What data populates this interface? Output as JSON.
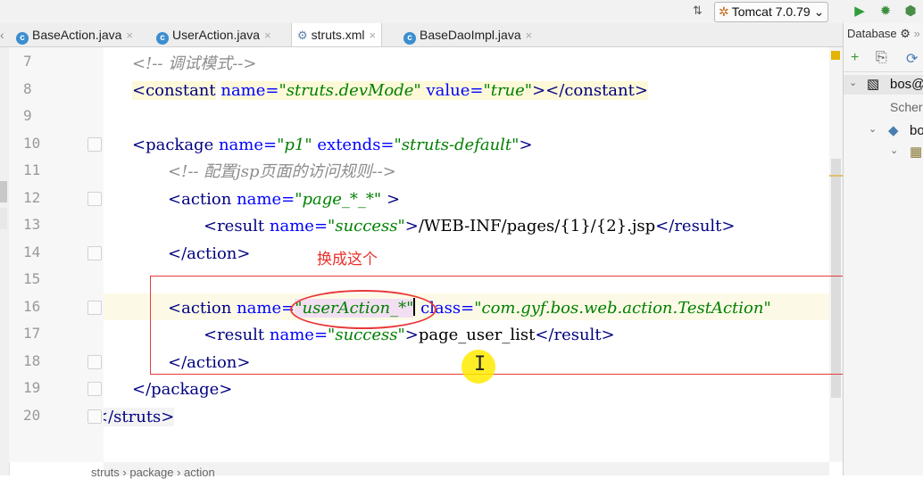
{
  "toolbar": {
    "run_config": "Tomcat 7.0.79",
    "sort_icon": "sort-icon",
    "run_icon": "run-icon",
    "debug_icon": "debug-icon",
    "coverage_icon": "coverage-icon"
  },
  "tabs": [
    {
      "label": "BaseAction.java",
      "icon": "class-icon"
    },
    {
      "label": "UserAction.java",
      "icon": "class-icon"
    },
    {
      "label": "struts.xml",
      "icon": "xml-icon",
      "active": true
    },
    {
      "label": "BaseDaoImpl.java",
      "icon": "class-icon"
    }
  ],
  "editor": {
    "line_numbers": [
      "7",
      "8",
      "9",
      "10",
      "11",
      "12",
      "13",
      "14",
      "15",
      "16",
      "17",
      "18",
      "19",
      "20"
    ],
    "lines": {
      "l7": {
        "comment": "<!-- 调试模式-->"
      },
      "l8": {
        "open": "<constant",
        "a1": "name=",
        "v1": "\"struts.devMode\"",
        "a2": "value=",
        "v2": "\"true\"",
        "close": "></constant>"
      },
      "l10": {
        "open": "<package",
        "a1": "name=",
        "v1": "\"p1\"",
        "a2": "extends=",
        "v2": "\"struts-default\"",
        "close": ">"
      },
      "l11": {
        "comment": "<!-- 配置jsp页面的访问规则-->"
      },
      "l12": {
        "open": "<action",
        "a1": "name=",
        "v1": "\"page_*_*\"",
        "close": ">"
      },
      "l13": {
        "open": "<result",
        "a1": "name=",
        "v1": "\"success\"",
        "close1": ">",
        "text": "/WEB-INF/pages/{1}/{2}.jsp",
        "close2": "</result>"
      },
      "l14": {
        "close": "</action>"
      },
      "l16": {
        "open": "<action",
        "a1": "name=",
        "v1": "\"userAction_*\"",
        "a2": "class=",
        "v2": "\"com.gyf.bos.web.action.TestAction\""
      },
      "l17": {
        "open": "<result",
        "a1": "name=",
        "v1": "\"success\"",
        "close1": ">",
        "text": "page_user_list",
        "close2": "</result>"
      },
      "l18": {
        "close": "</action>"
      },
      "l19": {
        "close": "</package>"
      },
      "l20": {
        "close": "</struts>"
      }
    }
  },
  "annotation": {
    "text": "换成这个",
    "color": "#e8312a"
  },
  "breadcrumb": "struts › package › action",
  "database_panel": {
    "title": "Database",
    "items": [
      "bos@",
      "Scher",
      "bo"
    ]
  },
  "colors": {
    "tag": "#000080",
    "attribute": "#0000ff",
    "string": "#008000",
    "comment": "#8c8c8c",
    "highlight": "#fcfae6"
  }
}
